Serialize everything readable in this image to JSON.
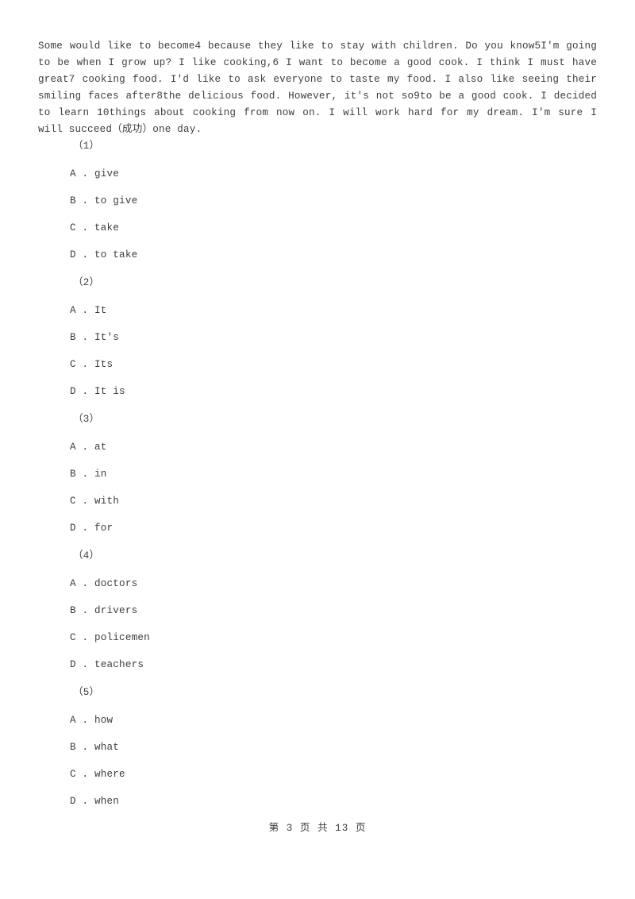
{
  "passage": {
    "text": "Some would like to become4 because they like to stay with children. Do you know5I'm going to be when I grow up? I like cooking,6 I want to become a good cook. I think I must have great7 cooking food. I'd like to ask everyone to taste my food. I also like seeing their smiling faces after8the delicious food. However, it's not so9to be a good cook. I decided to learn 10things about cooking from now on. I will work hard for my dream. I'm sure I will succeed（成功）one day."
  },
  "questions": [
    {
      "number": "（1）",
      "options": [
        {
          "label": "A . ",
          "text": "give"
        },
        {
          "label": "B . ",
          "text": "to give"
        },
        {
          "label": "C . ",
          "text": "take"
        },
        {
          "label": "D . ",
          "text": "to take"
        }
      ]
    },
    {
      "number": "（2）",
      "options": [
        {
          "label": "A . ",
          "text": "It"
        },
        {
          "label": "B . ",
          "text": "It's"
        },
        {
          "label": "C . ",
          "text": "Its"
        },
        {
          "label": "D . ",
          "text": "It is"
        }
      ]
    },
    {
      "number": "（3）",
      "options": [
        {
          "label": "A . ",
          "text": "at"
        },
        {
          "label": "B . ",
          "text": "in"
        },
        {
          "label": "C . ",
          "text": "with"
        },
        {
          "label": "D . ",
          "text": "for"
        }
      ]
    },
    {
      "number": "（4）",
      "options": [
        {
          "label": "A . ",
          "text": "doctors"
        },
        {
          "label": "B . ",
          "text": "drivers"
        },
        {
          "label": "C . ",
          "text": "policemen"
        },
        {
          "label": "D . ",
          "text": "teachers"
        }
      ]
    },
    {
      "number": "（5）",
      "options": [
        {
          "label": "A . ",
          "text": "how"
        },
        {
          "label": "B . ",
          "text": "what"
        },
        {
          "label": "C . ",
          "text": "where"
        },
        {
          "label": "D . ",
          "text": "when"
        }
      ]
    }
  ],
  "footer": {
    "page_indicator": "第 3 页 共 13 页"
  },
  "colors": {
    "text": "#3d3d3d",
    "background": "#ffffff"
  }
}
